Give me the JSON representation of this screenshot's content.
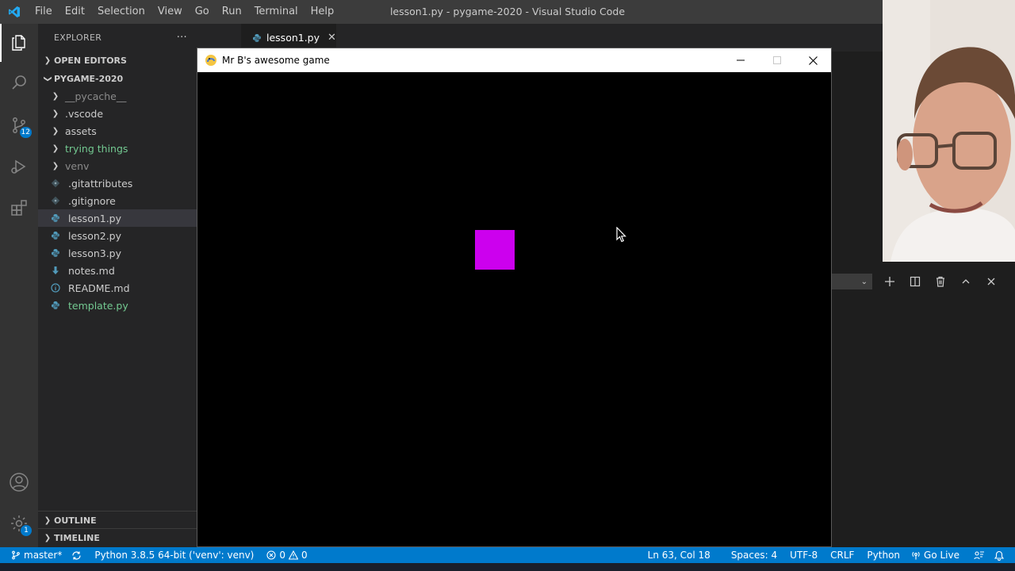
{
  "titlebar": {
    "menu": [
      "File",
      "Edit",
      "Selection",
      "View",
      "Go",
      "Run",
      "Terminal",
      "Help"
    ],
    "window_title": "lesson1.py - pygame-2020 - Visual Studio Code"
  },
  "activity_bar": {
    "scm_badge": "12",
    "settings_badge": "1"
  },
  "sidebar": {
    "header": "EXPLORER",
    "more": "···",
    "open_editors": "OPEN EDITORS",
    "project": "PYGAME-2020",
    "items": [
      {
        "label": "__pycache__",
        "kind": "folder",
        "style": "muted"
      },
      {
        "label": ".vscode",
        "kind": "folder",
        "style": "normal"
      },
      {
        "label": "assets",
        "kind": "folder",
        "style": "normal"
      },
      {
        "label": "trying things",
        "kind": "folder",
        "style": "green"
      },
      {
        "label": "venv",
        "kind": "folder",
        "style": "muted"
      },
      {
        "label": ".gitattributes",
        "kind": "git-icon",
        "style": "normal"
      },
      {
        "label": ".gitignore",
        "kind": "git-icon",
        "style": "normal"
      },
      {
        "label": "lesson1.py",
        "kind": "python-icon",
        "style": "normal"
      },
      {
        "label": "lesson2.py",
        "kind": "python-icon",
        "style": "normal"
      },
      {
        "label": "lesson3.py",
        "kind": "python-icon",
        "style": "normal"
      },
      {
        "label": "notes.md",
        "kind": "markdown-icon",
        "style": "normal"
      },
      {
        "label": "README.md",
        "kind": "info-icon",
        "style": "normal"
      },
      {
        "label": "template.py",
        "kind": "python-icon",
        "style": "green"
      }
    ],
    "outline": "OUTLINE",
    "timeline": "TIMELINE"
  },
  "editor": {
    "active_tab": "lesson1.py"
  },
  "pygame_window": {
    "title": "Mr B's awesome game",
    "square_color": "#cc00ee"
  },
  "statusbar": {
    "branch": "master*",
    "interpreter": "Python 3.8.5 64-bit ('venv': venv)",
    "errors": "0",
    "warnings": "0",
    "position": "Ln 63, Col 18",
    "spaces": "Spaces: 4",
    "encoding": "UTF-8",
    "eol": "CRLF",
    "language": "Python",
    "go_live": "Go Live"
  },
  "colors": {
    "accent": "#007acc",
    "folder_green": "#73c991",
    "python_icon": "#519aba"
  }
}
